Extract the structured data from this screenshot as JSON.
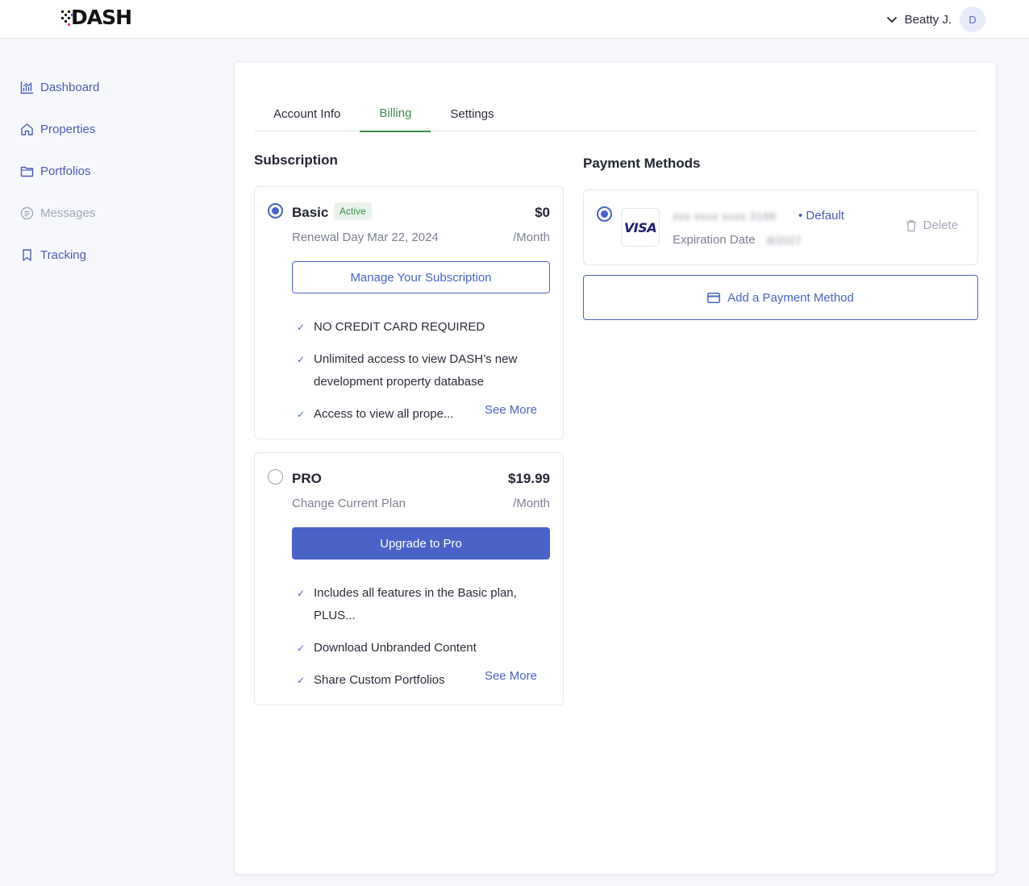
{
  "brand": {
    "logo_text": "DASH"
  },
  "user": {
    "name": "Beatty J.",
    "avatar_initial": "D"
  },
  "sidebar": {
    "items": [
      {
        "label": "Dashboard",
        "icon": "chart-icon"
      },
      {
        "label": "Properties",
        "icon": "home-icon"
      },
      {
        "label": "Portfolios",
        "icon": "folder-icon"
      },
      {
        "label": "Messages",
        "icon": "message-icon",
        "disabled": true
      },
      {
        "label": "Tracking",
        "icon": "bookmark-icon"
      }
    ]
  },
  "tabs": [
    {
      "label": "Account Info",
      "active": false
    },
    {
      "label": "Billing",
      "active": true
    },
    {
      "label": "Settings",
      "active": false
    }
  ],
  "subscription": {
    "title": "Subscription",
    "plans": [
      {
        "name": "Basic",
        "badge": "Active",
        "price": "$0",
        "period": "/Month",
        "subtitle": "Renewal Day Mar 22, 2024",
        "button": "Manage Your Subscription",
        "selected": true,
        "features": [
          "NO CREDIT CARD REQUIRED",
          "Unlimited access to view DASH’s new development property database",
          "Access to view all prope..."
        ],
        "see_more": "See More"
      },
      {
        "name": "PRO",
        "price": "$19.99",
        "period": "/Month",
        "subtitle": "Change Current Plan",
        "button": "Upgrade to Pro",
        "selected": false,
        "features": [
          "Includes all features in the Basic plan, PLUS...",
          "Download Unbranded Content",
          "Share Custom Portfolios"
        ],
        "see_more": "See More"
      }
    ]
  },
  "payment": {
    "title": "Payment Methods",
    "card": {
      "brand": "VISA",
      "masked_number": "xxx xxxx xxxx 3166",
      "default_label": "• Default",
      "expiration_label": "Expiration Date",
      "expiration_value": "8/2027",
      "delete_label": "Delete"
    },
    "add_label": "Add a Payment Method"
  },
  "colors": {
    "accent": "#4a63c8",
    "active_tab": "#3e8e4b",
    "badge_bg": "#eaf4ec"
  }
}
